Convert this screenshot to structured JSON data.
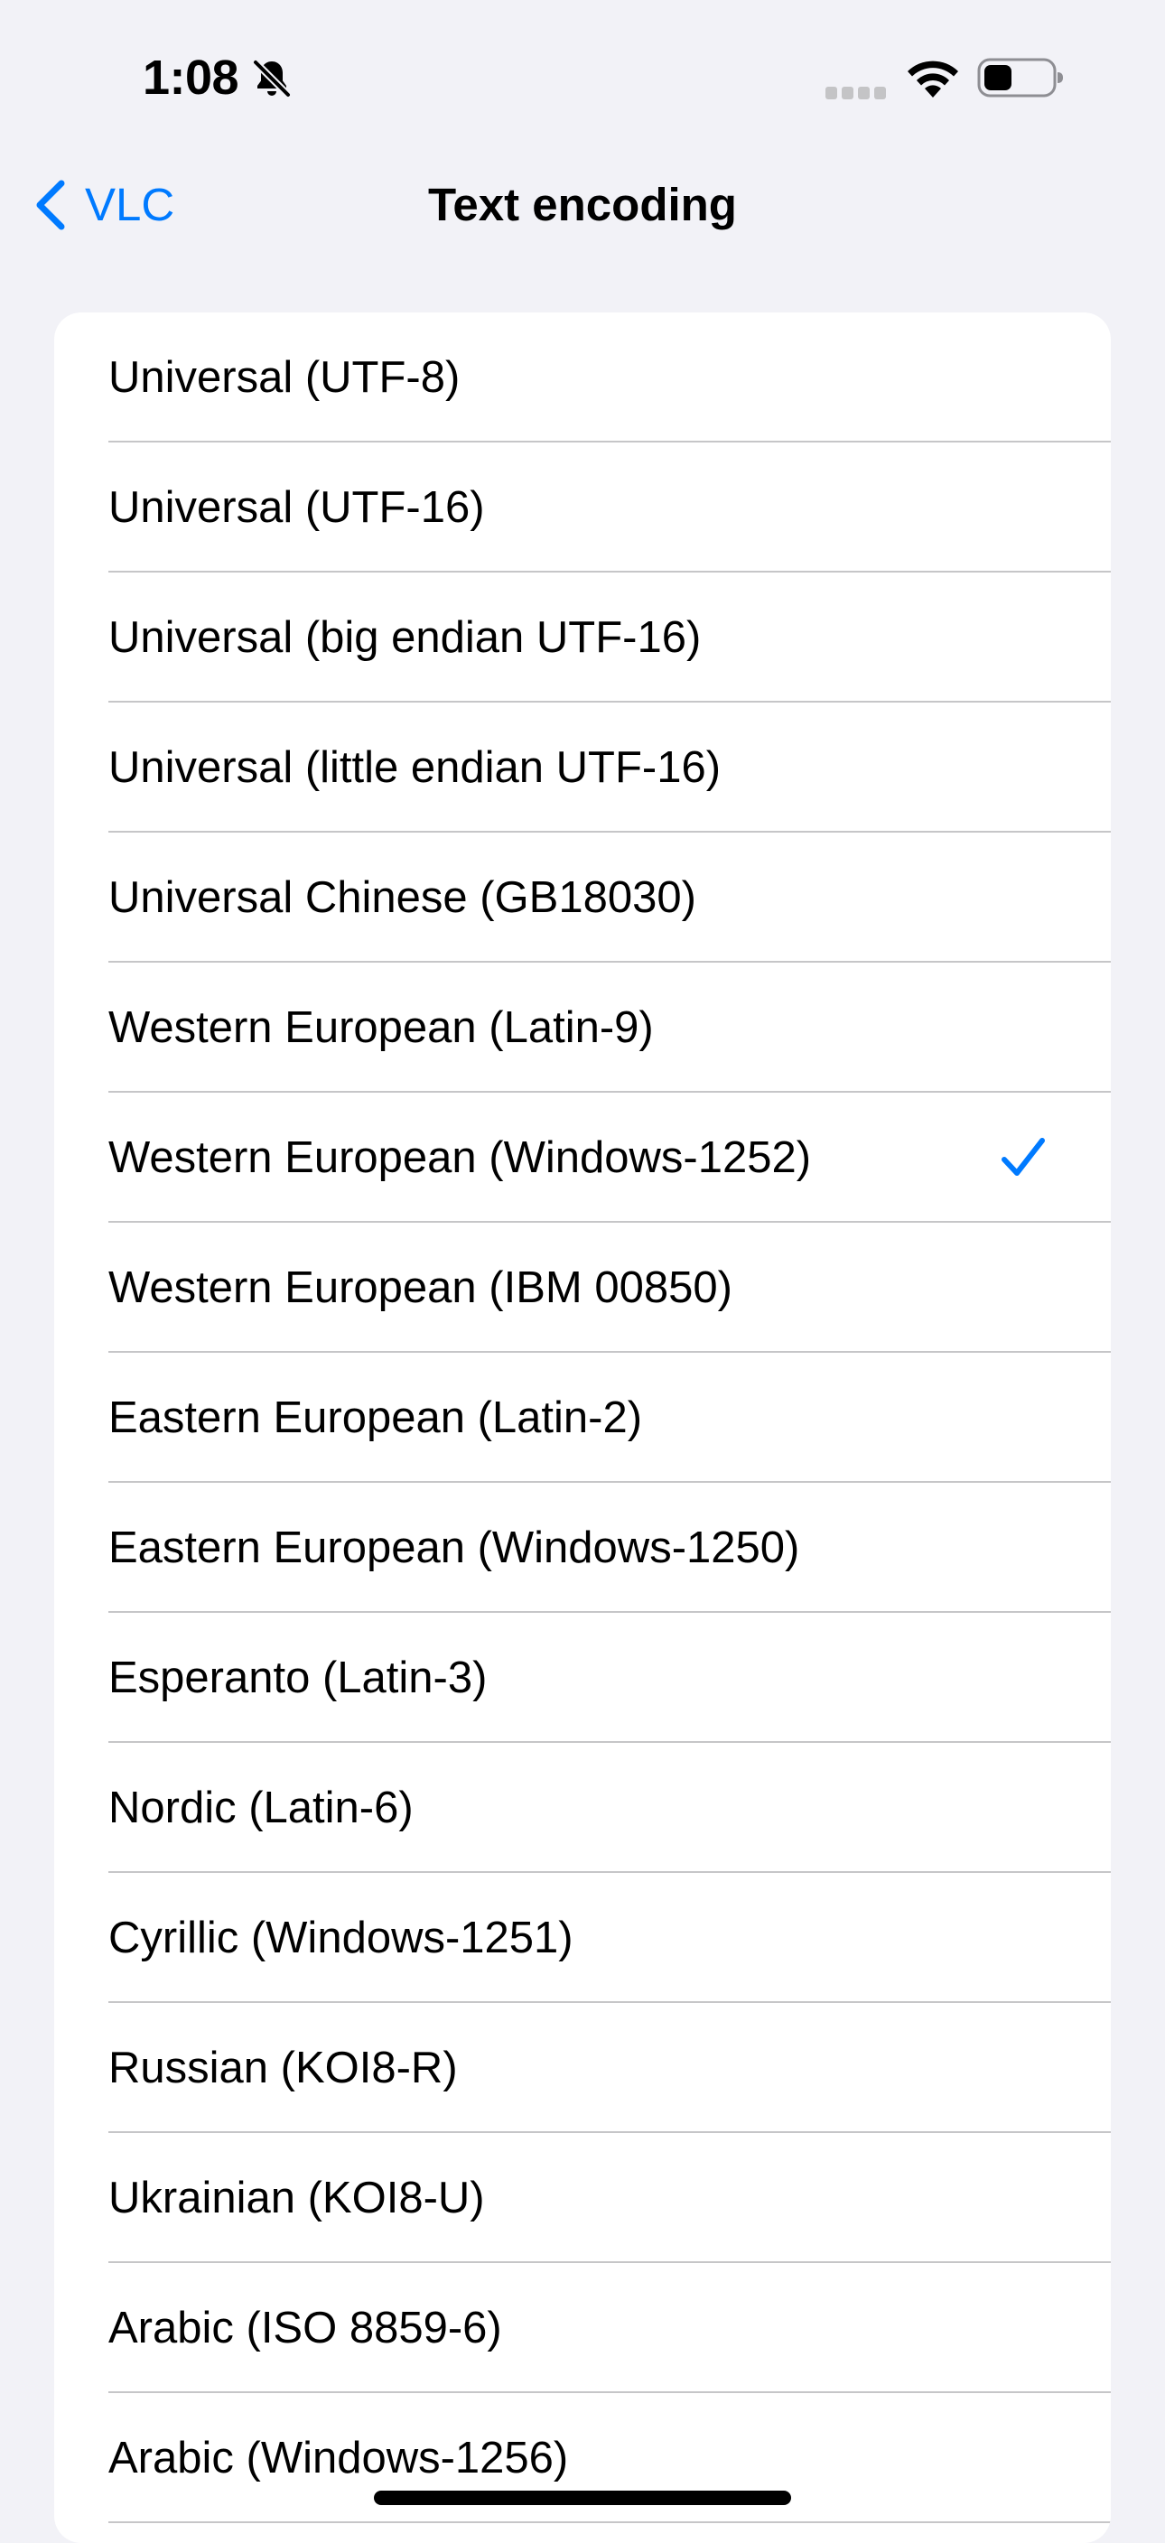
{
  "status_bar": {
    "time": "1:08",
    "icons": [
      "bell-slash-icon",
      "cellular-signal-icon",
      "wifi-icon",
      "battery-icon"
    ]
  },
  "nav": {
    "back_label": "VLC",
    "title": "Text encoding"
  },
  "accent_color": "#007aff",
  "encodings": [
    {
      "label": "Universal (UTF-8)",
      "selected": false
    },
    {
      "label": "Universal (UTF-16)",
      "selected": false
    },
    {
      "label": "Universal (big endian UTF-16)",
      "selected": false
    },
    {
      "label": "Universal (little endian UTF-16)",
      "selected": false
    },
    {
      "label": "Universal Chinese (GB18030)",
      "selected": false
    },
    {
      "label": "Western European (Latin-9)",
      "selected": false
    },
    {
      "label": "Western European (Windows-1252)",
      "selected": true
    },
    {
      "label": "Western European (IBM 00850)",
      "selected": false
    },
    {
      "label": "Eastern European (Latin-2)",
      "selected": false
    },
    {
      "label": "Eastern European (Windows-1250)",
      "selected": false
    },
    {
      "label": "Esperanto (Latin-3)",
      "selected": false
    },
    {
      "label": "Nordic (Latin-6)",
      "selected": false
    },
    {
      "label": "Cyrillic (Windows-1251)",
      "selected": false
    },
    {
      "label": "Russian (KOI8-R)",
      "selected": false
    },
    {
      "label": "Ukrainian (KOI8-U)",
      "selected": false
    },
    {
      "label": "Arabic (ISO 8859-6)",
      "selected": false
    },
    {
      "label": "Arabic (Windows-1256)",
      "selected": false
    }
  ]
}
